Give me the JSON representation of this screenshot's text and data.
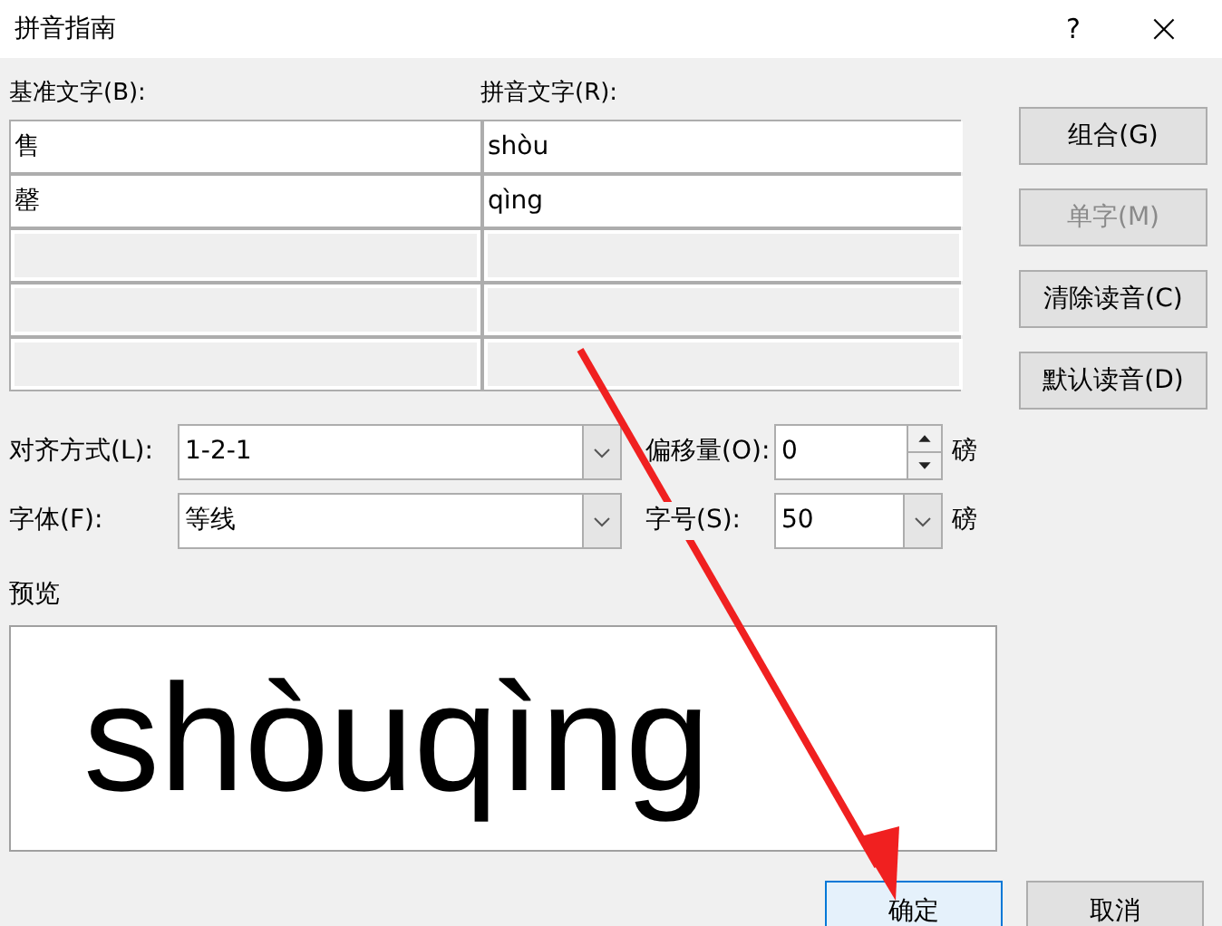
{
  "window": {
    "title": "拼音指南",
    "help": "?",
    "close": "×"
  },
  "table": {
    "columns": [
      "基准文字(B):",
      "拼音文字(R):"
    ],
    "rows": [
      {
        "base": "售",
        "ruby": "shòu"
      },
      {
        "base": "罄",
        "ruby": "qìng"
      }
    ]
  },
  "side_buttons": [
    {
      "label": "组合(G)",
      "disabled": false
    },
    {
      "label": "单字(M)",
      "disabled": true
    },
    {
      "label": "清除读音(C)",
      "disabled": false
    },
    {
      "label": "默认读音(D)",
      "disabled": false
    }
  ],
  "alignment": {
    "label": "对齐方式(L):",
    "value": "1-2-1"
  },
  "offset": {
    "label": "偏移量(O):",
    "value": "0",
    "unit": "磅"
  },
  "font": {
    "label": "字体(F):",
    "value": "等线"
  },
  "size": {
    "label": "字号(S):",
    "value": "50",
    "unit": "磅"
  },
  "preview": {
    "label": "预览",
    "text": "shòuqìng"
  },
  "buttons": [
    {
      "label": "确定",
      "focused": true
    },
    {
      "label": "取消",
      "focused": false
    }
  ]
}
